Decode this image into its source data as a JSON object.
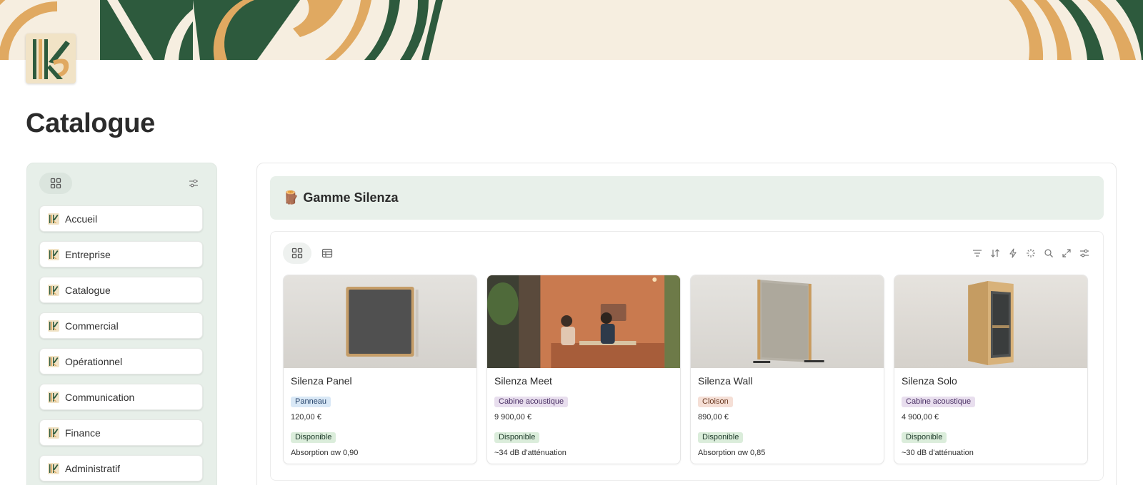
{
  "page": {
    "title": "Catalogue"
  },
  "sidebar": {
    "items": [
      {
        "label": "Accueil"
      },
      {
        "label": "Entreprise"
      },
      {
        "label": "Catalogue"
      },
      {
        "label": "Commercial"
      },
      {
        "label": "Opérationnel"
      },
      {
        "label": "Communication"
      },
      {
        "label": "Finance"
      },
      {
        "label": "Administratif"
      }
    ]
  },
  "callout": {
    "emoji": "🪵",
    "title": "Gamme Silenza"
  },
  "products": [
    {
      "name": "Silenza Panel",
      "type": "Panneau",
      "price": "120,00 €",
      "status": "Disponible",
      "spec": "Absorption αw 0,90"
    },
    {
      "name": "Silenza Meet",
      "type": "Cabine acoustique",
      "price": "9 900,00 €",
      "status": "Disponible",
      "spec": "~34 dB d'atténuation"
    },
    {
      "name": "Silenza Wall",
      "type": "Cloison",
      "price": "890,00 €",
      "status": "Disponible",
      "spec": "Absorption αw 0,85"
    },
    {
      "name": "Silenza Solo",
      "type": "Cabine acoustique",
      "price": "4 900,00 €",
      "status": "Disponible",
      "spec": "~30 dB d'atténuation"
    }
  ],
  "tag_colors": {
    "Panneau": {
      "bg": "#d9e8f6",
      "fg": "#28456c"
    },
    "Cabine acoustique": {
      "bg": "#e8deee",
      "fg": "#492f64"
    },
    "Cloison": {
      "bg": "#f5dfd6",
      "fg": "#6b3a22"
    },
    "Disponible": {
      "bg": "#dbeddb",
      "fg": "#1c3829"
    }
  },
  "icons": {
    "sidebar_toggle": "gallery-grid-icon",
    "sidebar_settings": "sliders-icon",
    "views": [
      "gallery-grid-icon",
      "table-icon"
    ],
    "toolbar": [
      "filter-icon",
      "sort-icon",
      "lightning-icon",
      "sparkle-icon",
      "search-icon",
      "expand-icon",
      "sliders-icon"
    ]
  },
  "colors": {
    "banner_green": "#2d5a3d",
    "banner_tan": "#e0a961",
    "sidebar_bg": "#e7efe9",
    "callout_bg": "#e8f0ea"
  }
}
